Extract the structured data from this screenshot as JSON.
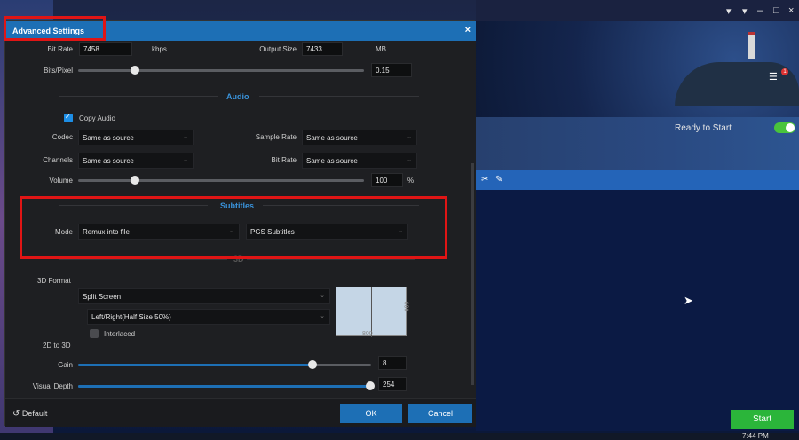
{
  "dialog": {
    "title": "Advanced Settings",
    "close_glyph": "×"
  },
  "video": {
    "bit_rate_label": "Bit Rate",
    "bit_rate_value": "7458",
    "bit_rate_unit": "kbps",
    "output_size_label": "Output Size",
    "output_size_value": "7433",
    "output_size_unit": "MB",
    "bits_per_pixel_label": "Bits/Pixel",
    "bits_per_pixel_value": "0.15",
    "bits_per_pixel_slider": 0.2
  },
  "audio": {
    "section_title": "Audio",
    "copy_audio_label": "Copy Audio",
    "copy_audio_checked": true,
    "codec_label": "Codec",
    "codec_value": "Same as source",
    "sample_rate_label": "Sample Rate",
    "sample_rate_value": "Same as source",
    "channels_label": "Channels",
    "channels_value": "Same as source",
    "bit_rate_label": "Bit Rate",
    "bit_rate_value": "Same as source",
    "volume_label": "Volume",
    "volume_value": "100",
    "volume_unit": "%",
    "volume_slider": 0.2
  },
  "subtitles": {
    "section_title": "Subtitles",
    "mode_label": "Mode",
    "mode_value": "Remux into file",
    "track_value": "PGS Subtitles"
  },
  "three_d": {
    "section_title": "3D",
    "format_label": "3D Format",
    "format_value": "Split Screen",
    "layout_value": "Left/Right(Half Size 50%)",
    "interlaced_label": "Interlaced",
    "interlaced_checked": false,
    "preview_width": "800",
    "preview_height": "600",
    "two_d_to_three_d_label": "2D to 3D",
    "gain_label": "Gain",
    "gain_value": "8",
    "gain_slider": 0.8,
    "visual_depth_label": "Visual Depth",
    "visual_depth_value": "254",
    "visual_depth_slider": 0.996
  },
  "footer": {
    "default_label": "Default",
    "ok_label": "OK",
    "cancel_label": "Cancel"
  },
  "app": {
    "ready_label": "Ready to Start",
    "start_label": "Start",
    "clock": "7:44 PM",
    "notification_count": "1"
  },
  "colors": {
    "accent": "#1d6fb5",
    "highlight_box": "#e01515",
    "start_green": "#2bb53a",
    "toggle_green": "#49c43b"
  }
}
